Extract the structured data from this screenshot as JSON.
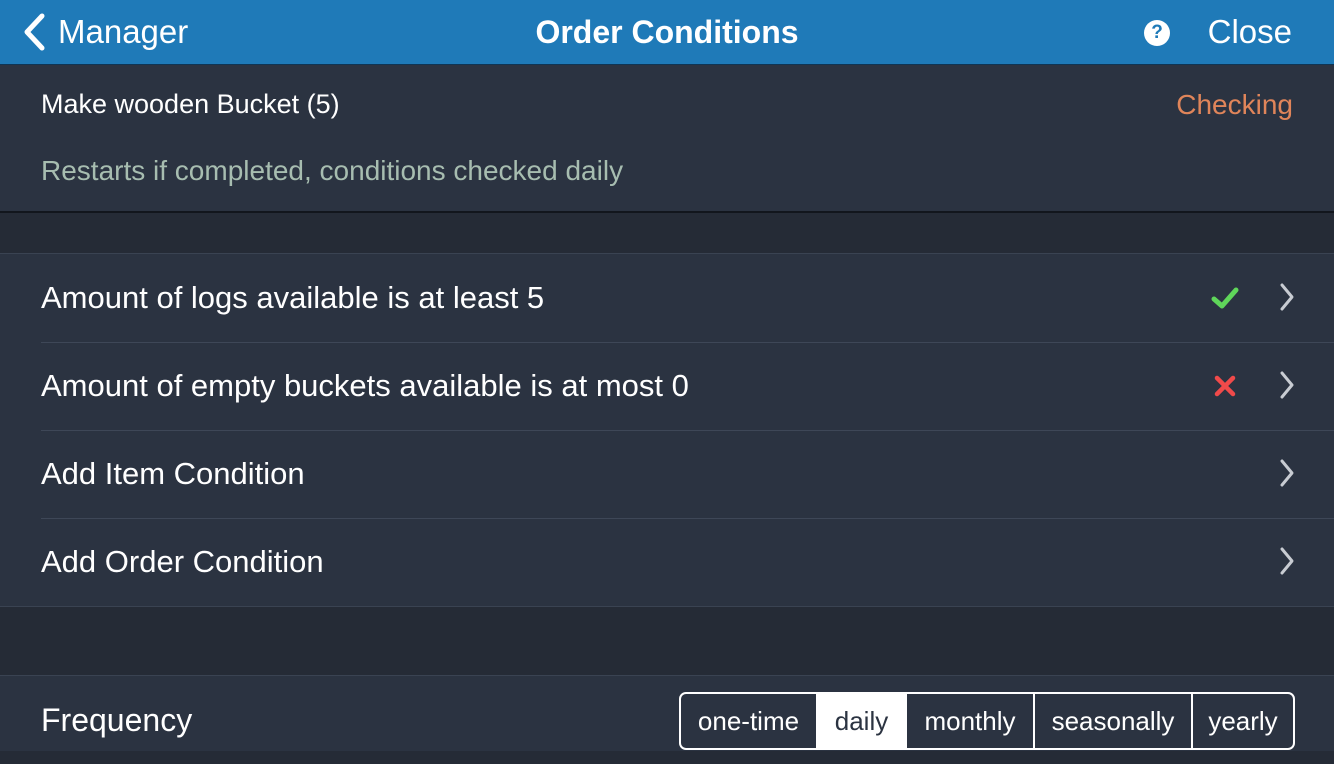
{
  "navbar": {
    "back_label": "Manager",
    "title": "Order Conditions",
    "help_icon": "question-circle-icon",
    "help_glyph": "?",
    "close_label": "Close"
  },
  "order": {
    "name": "Make wooden Bucket (5)",
    "status": "Checking",
    "description": "Restarts if completed, conditions checked daily"
  },
  "conditions": [
    {
      "label": "Amount of logs available is at least 5",
      "status_icon": "checkmark-icon",
      "met": true
    },
    {
      "label": "Amount of empty buckets available is at most 0",
      "status_icon": "cross-icon",
      "met": false
    },
    {
      "label": "Add Item Condition"
    },
    {
      "label": "Add Order Condition"
    }
  ],
  "frequency": {
    "label": "Frequency",
    "options": [
      "one-time",
      "daily",
      "monthly",
      "seasonally",
      "yearly"
    ],
    "selected": "daily"
  },
  "colors": {
    "navbar": "#1f7ab8",
    "background": "#252b36",
    "panel": "#2b3341",
    "status_checking": "#e0855a",
    "description": "#a7bdb0",
    "check": "#5fd65a",
    "cross": "#f04a4a"
  }
}
